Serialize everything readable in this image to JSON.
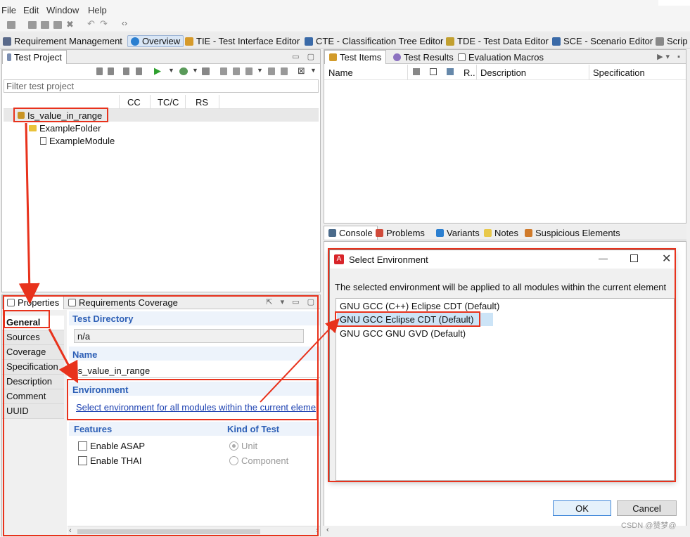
{
  "menu": [
    "File",
    "Edit",
    "Window",
    "Help"
  ],
  "perspectives": [
    {
      "label": "Requirement Management",
      "icon": "requirements-icon",
      "color": "#5a6a8a"
    },
    {
      "label": "Overview",
      "icon": "globe-icon",
      "color": "#2b7fd0"
    },
    {
      "label": "TIE - Test Interface Editor",
      "icon": "tie-icon",
      "color": "#d69a2a"
    },
    {
      "label": "CTE - Classification Tree Editor",
      "icon": "cte-icon",
      "color": "#3a6aa8"
    },
    {
      "label": "TDE - Test Data Editor",
      "icon": "tde-icon",
      "color": "#c2a030"
    },
    {
      "label": "SCE - Scenario Editor",
      "icon": "sce-icon",
      "color": "#3a6aa8"
    },
    {
      "label": "Scrip",
      "icon": "script-icon",
      "color": "#888888"
    }
  ],
  "test_project": {
    "tab_label": "Test Project",
    "filter_placeholder": "Filter test project",
    "columns": [
      "CC",
      "TC/C",
      "RS"
    ],
    "tree": [
      {
        "label": "Is_value_in_range",
        "icon": "environment-cube-icon"
      },
      {
        "label": "ExampleFolder",
        "icon": "folder-icon"
      },
      {
        "label": "ExampleModule",
        "icon": "module-file-icon"
      }
    ]
  },
  "test_items": {
    "tabs": [
      "Test Items",
      "Test Results",
      "Evaluation Macros"
    ],
    "columns": [
      "Name",
      "R..",
      "Description",
      "Specification"
    ]
  },
  "bottom_tabs": [
    "Console",
    "Problems",
    "Variants",
    "Notes",
    "Suspicious Elements"
  ],
  "properties": {
    "tabs": [
      "Properties",
      "Requirements Coverage"
    ],
    "side": [
      "General",
      "Sources",
      "Coverage",
      "Specification",
      "Description",
      "Comment",
      "UUID"
    ],
    "test_directory_label": "Test Directory",
    "test_directory_value": "n/a",
    "name_label": "Name",
    "name_value": "Is_value_in_range",
    "environment_label": "Environment",
    "environment_link": "Select environment for all modules within the current eleme",
    "features_label": "Features",
    "enable_asap": "Enable ASAP",
    "enable_thai": "Enable THAI",
    "kind_label": "Kind of Test",
    "kind_unit": "Unit",
    "kind_component": "Component"
  },
  "dialog": {
    "title": "Select Environment",
    "description": "The selected environment will be applied to all modules within the current element",
    "options": [
      "GNU GCC (C++) Eclipse CDT (Default)",
      "GNU GCC Eclipse CDT (Default)",
      "GNU GCC GNU GVD (Default)"
    ],
    "selected_index": 1,
    "ok": "OK",
    "cancel": "Cancel"
  },
  "watermark": "CSDN @赞梦@",
  "colors": {
    "annotation_red": "#e8321c",
    "selection_blue": "#cce4f7",
    "link_blue": "#1a3fb0"
  }
}
